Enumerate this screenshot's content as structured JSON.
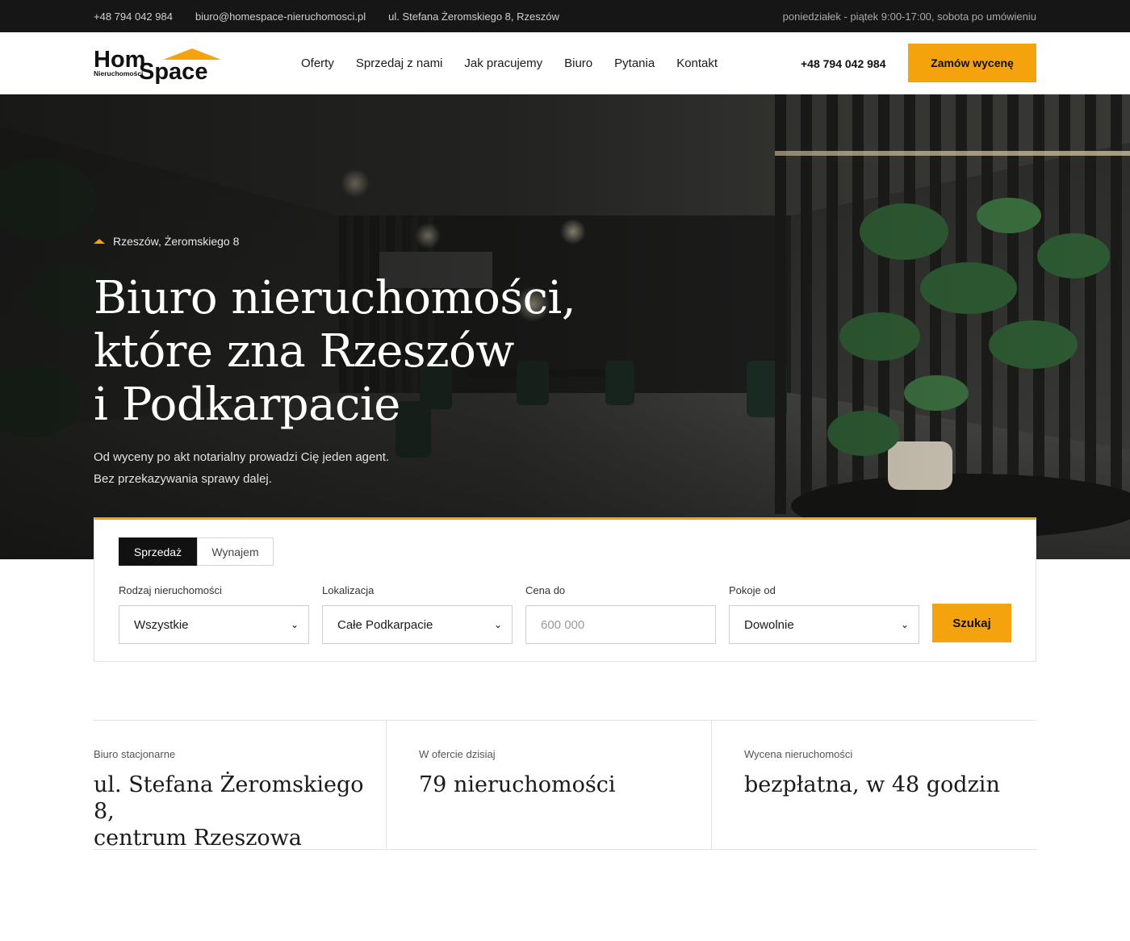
{
  "topbar": {
    "phone": "+48 794 042 984",
    "email": "biuro@homespace-nieruchomosci.pl",
    "address": "ul. Stefana Żeromskiego 8, Rzeszów",
    "hours": "poniedziałek - piątek 9:00-17:00, sobota po umówieniu"
  },
  "logo": {
    "word1": "Hom",
    "word2": "Space",
    "tagline": "Nieruchomości"
  },
  "nav": {
    "items": [
      "Oferty",
      "Sprzedaj z nami",
      "Jak pracujemy",
      "Biuro",
      "Pytania",
      "Kontakt"
    ]
  },
  "header": {
    "phone": "+48 794 042 984",
    "cta_label": "Zamów wycenę"
  },
  "hero": {
    "location": "Rzeszów, Żeromskiego 8",
    "title_lines": [
      "Biuro nieruchomości,",
      "które zna Rzeszów",
      "i Podkarpacie"
    ],
    "subtitle_lines": [
      "Od wyceny po akt notarialny prowadzi Cię jeden agent.",
      "Bez przekazywania sprawy dalej."
    ]
  },
  "search": {
    "tabs": [
      "Sprzedaż",
      "Wynajem"
    ],
    "active_tab": "Sprzedaż",
    "fields": [
      {
        "label": "Rodzaj nieruchomości",
        "value": "Wszystkie"
      },
      {
        "label": "Lokalizacja",
        "value": "Całe Podkarpacie"
      },
      {
        "label": "Cena do",
        "placeholder": "600 000"
      },
      {
        "label": "Pokoje od",
        "value": "Dowolnie"
      }
    ],
    "button_label": "Szukaj"
  },
  "info": [
    {
      "label": "Biuro stacjonarne",
      "value_lines": [
        "ul. Stefana Żeromskiego 8,",
        "centrum Rzeszowa"
      ]
    },
    {
      "label": "W ofercie dzisiaj",
      "value_lines": [
        "79 nieruchomości"
      ]
    },
    {
      "label": "Wycena nieruchomości",
      "value_lines": [
        "bezpłatna, w 48 godzin"
      ]
    }
  ],
  "colors": {
    "accent": "#f5a30d",
    "dark": "#161616"
  }
}
